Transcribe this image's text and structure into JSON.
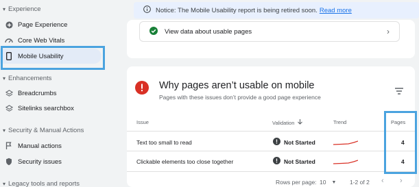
{
  "sidebar": {
    "sections": [
      {
        "label": "Experience"
      },
      {
        "label": "Enhancements"
      },
      {
        "label": "Security & Manual Actions"
      },
      {
        "label": "Legacy tools and reports"
      }
    ],
    "items": [
      {
        "label": "Page Experience",
        "icon": "plus-circle-icon"
      },
      {
        "label": "Core Web Vitals",
        "icon": "speedometer-icon"
      },
      {
        "label": "Mobile Usability",
        "icon": "phone-icon"
      },
      {
        "label": "Breadcrumbs",
        "icon": "layers-icon"
      },
      {
        "label": "Sitelinks searchbox",
        "icon": "layers-icon"
      },
      {
        "label": "Manual actions",
        "icon": "flag-icon"
      },
      {
        "label": "Security issues",
        "icon": "shield-icon"
      }
    ]
  },
  "notice": {
    "text": "Notice: The Mobile Usability report is being retired soon.",
    "link": "Read more"
  },
  "usable": {
    "label": "View data about usable pages"
  },
  "issues": {
    "title": "Why pages aren’t usable on mobile",
    "subtitle": "Pages with these issues don’t provide a good page experience",
    "columns": {
      "issue": "Issue",
      "validation": "Validation",
      "trend": "Trend",
      "pages": "Pages"
    },
    "rows": [
      {
        "issue": "Text too small to read",
        "validation": "Not Started",
        "pages": "4"
      },
      {
        "issue": "Clickable elements too close together",
        "validation": "Not Started",
        "pages": "4"
      }
    ],
    "footer": {
      "rows_per_page_label": "Rows per page:",
      "rows_per_page": "10",
      "range": "1-2 of 2"
    }
  },
  "colors": {
    "accent": "#1a73e8",
    "error": "#d93025",
    "success": "#188038",
    "highlight": "#4aa3df"
  }
}
